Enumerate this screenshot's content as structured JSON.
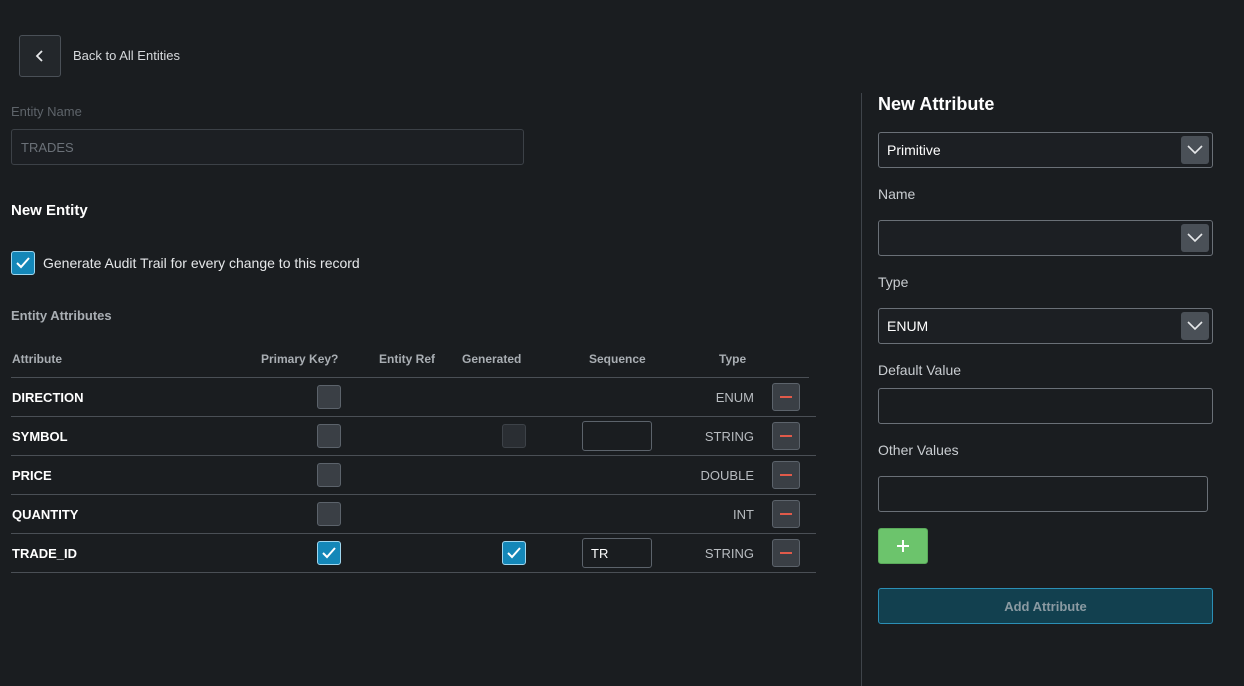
{
  "back": {
    "label": "Back to All Entities",
    "icon": "chevron-left-icon"
  },
  "entity": {
    "name_label": "Entity Name",
    "name_value": "TRADES",
    "section_title": "New Entity",
    "audit_label": "Generate Audit Trail for every change to this record",
    "audit_checked": true
  },
  "attributes": {
    "title": "Entity Attributes",
    "columns": [
      "Attribute",
      "Primary Key?",
      "Entity Ref",
      "Generated",
      "Sequence",
      "Type"
    ],
    "rows": [
      {
        "name": "DIRECTION",
        "primary_key": false,
        "generated": null,
        "sequence": null,
        "type": "ENUM"
      },
      {
        "name": "SYMBOL",
        "primary_key": false,
        "generated": false,
        "sequence": "",
        "type": "STRING"
      },
      {
        "name": "PRICE",
        "primary_key": false,
        "generated": null,
        "sequence": null,
        "type": "DOUBLE"
      },
      {
        "name": "QUANTITY",
        "primary_key": false,
        "generated": null,
        "sequence": null,
        "type": "INT"
      },
      {
        "name": "TRADE_ID",
        "primary_key": true,
        "generated": true,
        "sequence": "TR",
        "type": "STRING"
      }
    ]
  },
  "new_attribute": {
    "title": "New Attribute",
    "kind_value": "Primitive",
    "name_label": "Name",
    "name_value": "",
    "type_label": "Type",
    "type_value": "ENUM",
    "default_label": "Default Value",
    "default_value": "",
    "other_label": "Other Values",
    "other_value": "",
    "plus_icon": "plus-icon",
    "add_button_label": "Add Attribute"
  },
  "colors": {
    "background": "#1a1d20",
    "checkbox_checked": "#1487b8",
    "remove_icon": "#e05a4a",
    "plus_button": "#6cc46c",
    "add_button": "#12404f"
  }
}
